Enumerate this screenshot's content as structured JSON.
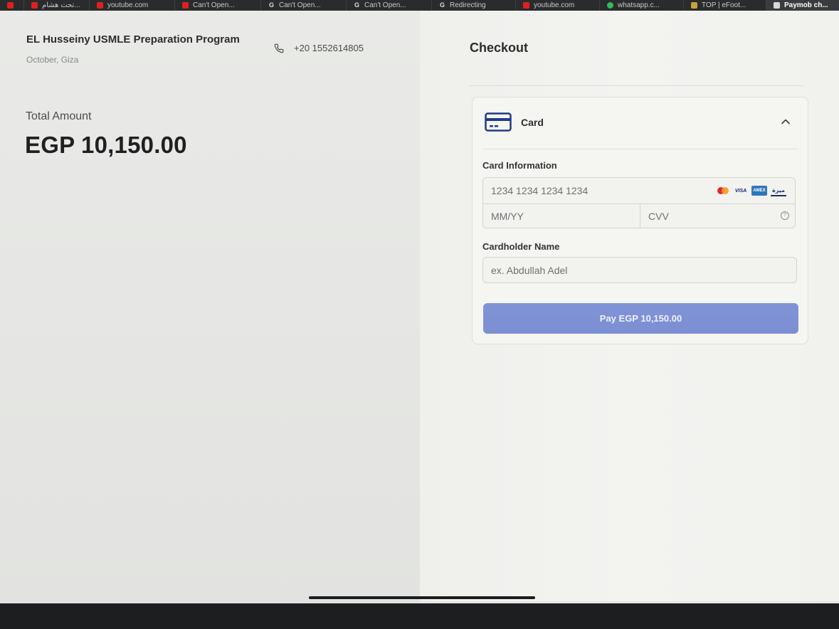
{
  "browser": {
    "tabs": [
      {
        "icon": "youtube-icon",
        "label": ""
      },
      {
        "icon": "youtube-icon",
        "label": "تحت هشام..."
      },
      {
        "icon": "youtube-icon",
        "label": "youtube.com"
      },
      {
        "icon": "youtube-icon",
        "label": "Can't Open..."
      },
      {
        "icon": "google-icon",
        "label": "Can't Open..."
      },
      {
        "icon": "google-icon",
        "label": "Can't Open..."
      },
      {
        "icon": "google-icon",
        "label": "Redirecting"
      },
      {
        "icon": "youtube-icon",
        "label": "youtube.com"
      },
      {
        "icon": "whatsapp-icon",
        "label": "whatsapp.c..."
      },
      {
        "icon": "efootball-icon",
        "label": "TOP | eFoot..."
      },
      {
        "icon": "paymob-icon",
        "label": "Paymob ch..."
      }
    ]
  },
  "merchant": {
    "name": "EL Husseiny USMLE Preparation Program",
    "location": "October, Giza",
    "phone": "+20 1552614805"
  },
  "summary": {
    "total_label": "Total Amount",
    "total_amount": "EGP 10,150.00"
  },
  "checkout": {
    "title": "Checkout",
    "method_label": "Card",
    "card_info_label": "Card Information",
    "card_number_placeholder": "1234 1234 1234 1234",
    "expiry_placeholder": "MM/YY",
    "cvv_placeholder": "CVV",
    "cardholder_label": "Cardholder Name",
    "cardholder_placeholder": "ex. Abdullah Adel",
    "pay_button": "Pay EGP 10,150.00",
    "brands": {
      "visa": "VISA",
      "amex": "AMEX",
      "meeza": "ميزة"
    }
  },
  "colors": {
    "pay_button": "#7d8fd3",
    "card_icon": "#1f3a8a",
    "mastercard_red": "#e3262f",
    "mastercard_orange": "#f39b1c"
  }
}
